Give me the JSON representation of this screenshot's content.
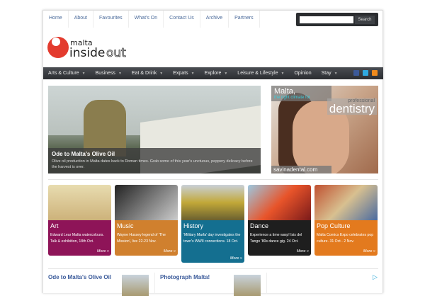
{
  "top_nav": [
    "Home",
    "About",
    "Favourites",
    "What's On",
    "Contact Us",
    "Archive",
    "Partners"
  ],
  "search": {
    "button": "Search",
    "value": ""
  },
  "logo": {
    "line1": "malta",
    "line2a": "inside",
    "line2b": "out"
  },
  "main_nav": [
    {
      "label": "Arts & Culture",
      "dropdown": true
    },
    {
      "label": "Business",
      "dropdown": true
    },
    {
      "label": "Eat & Drink",
      "dropdown": true
    },
    {
      "label": "Expats",
      "dropdown": true
    },
    {
      "label": "Explore",
      "dropdown": true
    },
    {
      "label": "Leisure & Lifestyle",
      "dropdown": true
    },
    {
      "label": "Opinion",
      "dropdown": false
    },
    {
      "label": "Stay",
      "dropdown": true
    }
  ],
  "social": [
    "facebook",
    "twitter",
    "rss"
  ],
  "hero": {
    "title": "Ode to Malta's Olive Oil",
    "text": "Olive oil production in Malta dates back to Roman times. Grab some of this year's unctuous, peppery delicacy before the harvest is over."
  },
  "ad": {
    "line1": "Malta,",
    "line2": "the right climate for",
    "line3": "professional",
    "line4": "dentistry",
    "url": "savinadental.com"
  },
  "cards": [
    {
      "title": "Art",
      "text": "Edward Lear Malta watercolours. Talk & exhibition, 18th Oct.",
      "more": "More »",
      "color": "#8e1458"
    },
    {
      "title": "Music",
      "text": "Wayne Hussey legend of 'The Mission', live 22-23 Nov.",
      "more": "More »",
      "color": "#d0802e"
    },
    {
      "title": "History",
      "text": "'Military Marfa' day investigates the town's WWII connections. 18 Oct.",
      "more": "More »",
      "color": "#146f90"
    },
    {
      "title": "Dance",
      "text": "Experience a time warp! Isis del Tango '80s dance gig. 24 Oct.",
      "more": "More »",
      "color": "#1e1e1e"
    },
    {
      "title": "Pop Culture",
      "text": "Malta Comics Expo celebrates pop culture. 31 Oct - 2 Nov.",
      "more": "More »",
      "color": "#e37a1e"
    }
  ],
  "bottom": [
    {
      "title": "Ode to Malta's Olive Oil"
    },
    {
      "title": "Photograph Malta!"
    }
  ]
}
